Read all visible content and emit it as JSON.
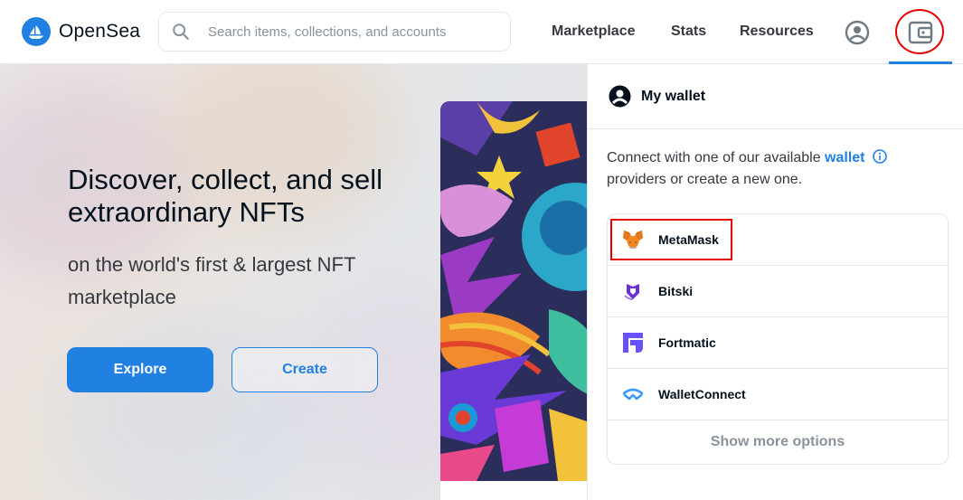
{
  "header": {
    "logo_text": "OpenSea",
    "search_placeholder": "Search items, collections, and accounts",
    "nav": {
      "marketplace": "Marketplace",
      "stats": "Stats",
      "resources": "Resources"
    }
  },
  "hero": {
    "title": "Discover, collect, and sell extraordinary NFTs",
    "subtitle": "on the world's first & largest NFT marketplace",
    "explore_label": "Explore",
    "create_label": "Create"
  },
  "wallet_panel": {
    "title": "My wallet",
    "desc_prefix": "Connect with one of our available",
    "desc_link": "wallet",
    "desc_suffix": "providers or create a new one.",
    "providers": [
      {
        "label": "MetaMask",
        "icon": "metamask-fox-icon"
      },
      {
        "label": "Bitski",
        "icon": "bitski-icon"
      },
      {
        "label": "Fortmatic",
        "icon": "fortmatic-icon"
      },
      {
        "label": "WalletConnect",
        "icon": "walletconnect-icon"
      }
    ],
    "show_more_label": "Show more options"
  },
  "colors": {
    "brand": "#2081e2",
    "highlight": "#e60000",
    "text_primary": "#04111d",
    "text_muted": "#8a939b"
  }
}
